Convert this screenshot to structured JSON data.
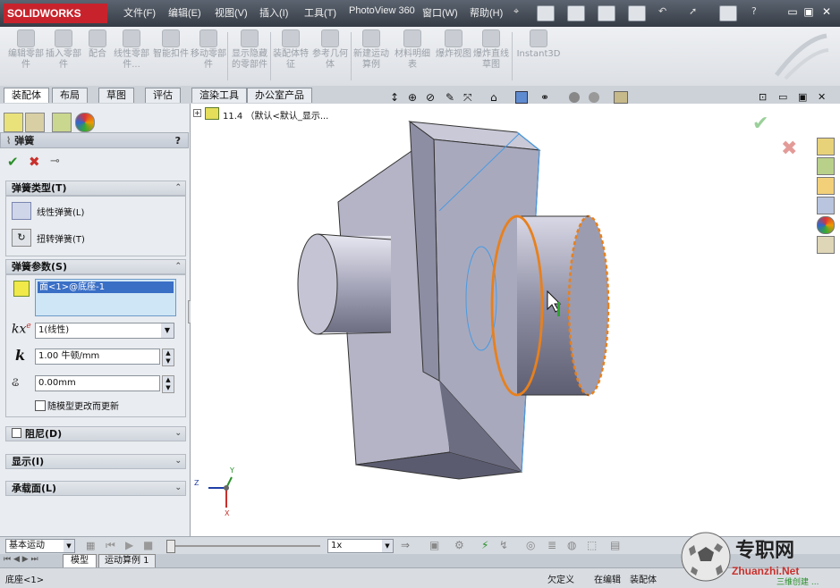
{
  "app": {
    "logo": "SOLIDWORKS"
  },
  "menu": [
    "文件(F)",
    "编辑(E)",
    "视图(V)",
    "插入(I)",
    "工具(T)",
    "PhotoView 360",
    "窗口(W)",
    "帮助(H)"
  ],
  "commands": [
    {
      "label": "编辑零部件",
      "icon": "edit-component-icon"
    },
    {
      "label": "插入零部件",
      "icon": "insert-component-icon"
    },
    {
      "label": "配合",
      "icon": "mate-icon"
    },
    {
      "label": "线性零部件...",
      "icon": "linear-pattern-icon"
    },
    {
      "label": "智能扣件",
      "icon": "smart-fastener-icon"
    },
    {
      "label": "移动零部件",
      "icon": "move-component-icon"
    },
    {
      "label": "显示隐藏的零部件",
      "icon": "show-hidden-icon"
    },
    {
      "label": "装配体特征",
      "icon": "assembly-feature-icon"
    },
    {
      "label": "参考几何体",
      "icon": "reference-geometry-icon"
    },
    {
      "label": "新建运动算例",
      "icon": "new-motion-study-icon"
    },
    {
      "label": "材料明细表",
      "icon": "bom-icon"
    },
    {
      "label": "爆炸视图",
      "icon": "exploded-view-icon"
    },
    {
      "label": "爆炸直线草图",
      "icon": "explode-line-icon"
    },
    {
      "label": "Instant3D",
      "icon": "instant3d-icon"
    }
  ],
  "tabs": [
    "装配体",
    "布局",
    "草图",
    "评估",
    "渲染工具",
    "办公室产品"
  ],
  "feature_tree": {
    "root": "11.4 （默认<默认_显示..."
  },
  "property_manager": {
    "title": "弹簧",
    "help": "?",
    "spring_type": {
      "header": "弹簧类型(T)",
      "options": [
        "线性弹簧(L)",
        "扭转弹簧(T)"
      ]
    },
    "spring_params": {
      "header": "弹簧参数(S)",
      "selected_face": "面<1>@底座-1",
      "exponent_label": "kx",
      "exponent_sup": "e",
      "exponent_value": "1(线性)",
      "k_label": "k",
      "k_value": "1.00 牛顿/mm",
      "length_value": "0.00mm",
      "update_checkbox": "随模型更改而更新"
    },
    "damper": "阻尼(D)",
    "display": "显示(I)",
    "load_faces": "承载面(L)"
  },
  "motion": {
    "study_type": "基本运动",
    "speed": "1x"
  },
  "bottom_tabs": [
    "模型",
    "运动算例 1"
  ],
  "status": {
    "left": "底座<1>",
    "defined": "欠定义",
    "editing": "在编辑",
    "mode": "装配体"
  },
  "axes": {
    "y": "Y",
    "z": "Z",
    "x": "X"
  },
  "watermark": {
    "cn": "专职网",
    "url": "Zhuanzhi.Net",
    "sub": "三维创建 ..."
  },
  "colors": {
    "accent_orange": "#e8801c",
    "ok_green": "#2a8f2a",
    "cancel_red": "#c9302c"
  }
}
